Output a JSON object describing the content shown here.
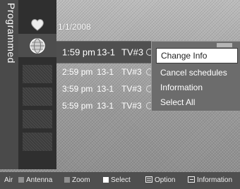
{
  "sidebar": {
    "label": "Programmed"
  },
  "list": {
    "date": "1/1/2008",
    "rows": [
      {
        "time": "1:59 pm",
        "channel": "13-1",
        "name": "TV#3"
      },
      {
        "time": "2:59 pm",
        "channel": "13-1",
        "name": "TV#3"
      },
      {
        "time": "3:59 pm",
        "channel": "13-1",
        "name": "TV#3"
      },
      {
        "time": "5:59 pm",
        "channel": "13-1",
        "name": "TV#3"
      }
    ]
  },
  "popup": {
    "items": [
      "Change Info",
      "Cancel schedules",
      "Information",
      "Select All"
    ],
    "selected_index": 0
  },
  "footer": {
    "air": "Air",
    "antenna": "Antenna",
    "zoom": "Zoom",
    "select": "Select",
    "option": "Option",
    "information": "Information"
  },
  "icons": {
    "heart": "heart-icon",
    "globe": "globe-icon",
    "option": "option-icon",
    "info": "info-icon"
  },
  "colors": {
    "panel": "#4f4f4f",
    "popup": "#6c6c6c",
    "highlight": "#ffffff"
  }
}
